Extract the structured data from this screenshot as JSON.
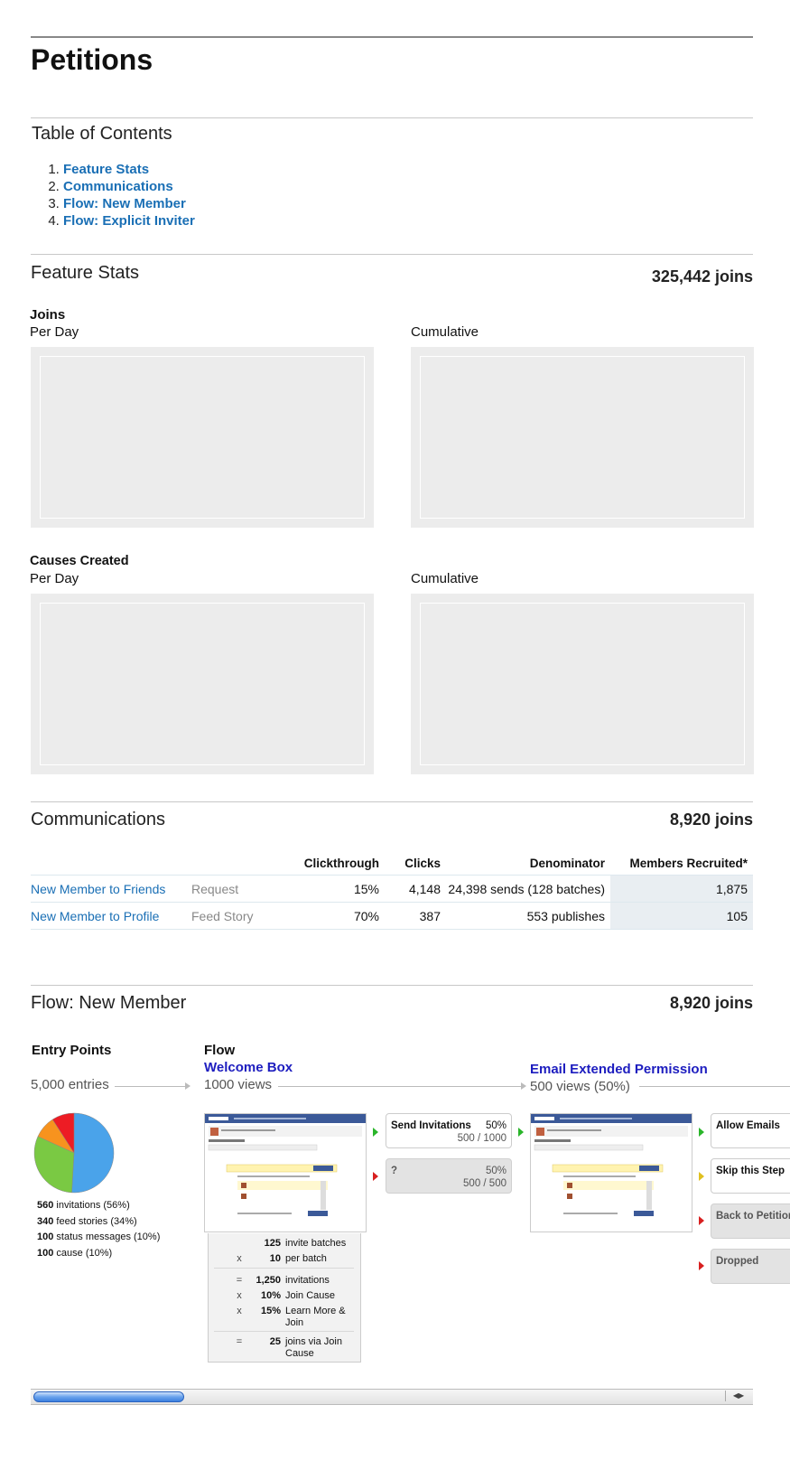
{
  "page": {
    "title": "Petitions"
  },
  "toc": {
    "heading": "Table of Contents",
    "items": [
      "Feature Stats",
      "Communications",
      "Flow: New Member",
      "Flow: Explicit Inviter"
    ]
  },
  "feature_stats": {
    "heading": "Feature Stats",
    "joins": "325,442 joins",
    "joins_label": "Joins",
    "causes_label": "Causes Created",
    "per_day": "Per Day",
    "cumulative": "Cumulative"
  },
  "communications": {
    "heading": "Communications",
    "joins": "8,920 joins",
    "columns": [
      "Clickthrough",
      "Clicks",
      "Denominator",
      "Members Recruited*"
    ],
    "rows": [
      {
        "name": "New Member to Friends",
        "type": "Request",
        "clickthrough": "15%",
        "clicks": "4,148",
        "denominator": "24,398 sends (128 batches)",
        "recruited": "1,875"
      },
      {
        "name": "New Member to Profile",
        "type": "Feed Story",
        "clickthrough": "70%",
        "clicks": "387",
        "denominator": "553 publishes",
        "recruited": "105"
      }
    ]
  },
  "flow": {
    "heading": "Flow: New Member",
    "joins": "8,920 joins",
    "entry_points_label": "Entry Points",
    "entries": "5,000 entries",
    "flow_label": "Flow",
    "welcome_box": {
      "title": "Welcome Box",
      "views": "1000 views"
    },
    "email_perm": {
      "title": "Email Extended Permission",
      "views": "500 views (50%)"
    },
    "send_invitations": {
      "label": "Send Invitations",
      "pct": "50%",
      "ratio": "500 / 1000"
    },
    "unknown": {
      "label": "?",
      "pct": "50%",
      "ratio": "500 / 500"
    },
    "allow_emails": "Allow Emails",
    "skip_step": "Skip this Step",
    "back_to_petition": "Back to Petition",
    "dropped": "Dropped",
    "pie_legend": [
      {
        "n": "560",
        "text": "invitations (56%)"
      },
      {
        "n": "340",
        "text": "feed stories (34%)"
      },
      {
        "n": "100",
        "text": "status messages (10%)"
      },
      {
        "n": "100",
        "text": "cause (10%)"
      }
    ],
    "pie_values": [
      {
        "label": "invitations",
        "value": 56,
        "color": "#4aa3ea"
      },
      {
        "label": "feed stories",
        "value": 34,
        "color": "#7ac943"
      },
      {
        "label": "status messages",
        "value": 10,
        "color": "#f7931e"
      },
      {
        "label": "cause",
        "value": 10,
        "color": "#ed1c24"
      }
    ],
    "calc": [
      {
        "op": "",
        "n": "125",
        "t": "invite batches"
      },
      {
        "op": "x",
        "n": "10",
        "t": "per batch"
      },
      {
        "op": "=",
        "n": "1,250",
        "t": "invitations"
      },
      {
        "op": "x",
        "n": "10%",
        "t": "Join Cause"
      },
      {
        "op": "x",
        "n": "15%",
        "t": "Learn More & Join"
      },
      {
        "op": "=",
        "n": "25",
        "t": "joins via Join Cause"
      }
    ]
  }
}
